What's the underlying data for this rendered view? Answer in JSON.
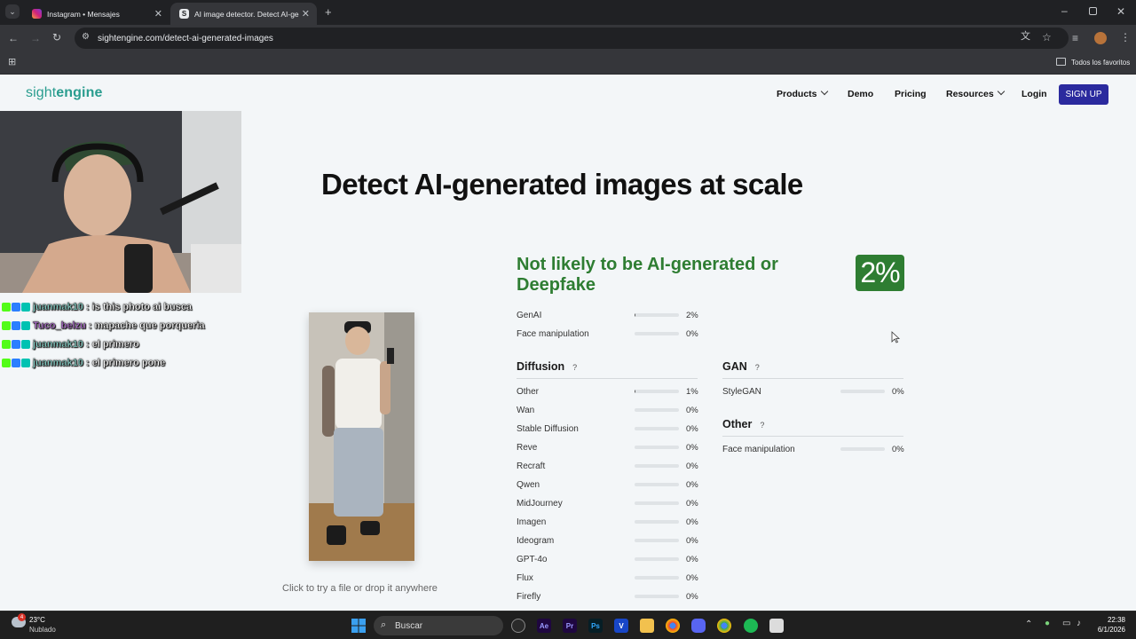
{
  "browser": {
    "tabs": [
      {
        "title": "Instagram • Mensajes"
      },
      {
        "title": "AI image detector. Detect AI-gen"
      }
    ],
    "url": "sightengine.com/detect-ai-generated-images",
    "bookmarks_label": "Todos los favoritos"
  },
  "site": {
    "logo_light": "sight",
    "logo_bold": "engine",
    "nav": {
      "products": "Products",
      "demo": "Demo",
      "pricing": "Pricing",
      "resources": "Resources",
      "login": "Login",
      "signup": "SIGN UP"
    },
    "headline": "Detect AI-generated images at scale",
    "result_title": "Not likely to be AI-generated or Deepfake",
    "score": "2%",
    "drop_hint": "Click to try a file or drop it anywhere"
  },
  "results": {
    "summary": [
      {
        "label": "GenAI",
        "pct": "2%",
        "value": 0.02
      },
      {
        "label": "Face manipulation",
        "pct": "0%",
        "value": 0
      }
    ],
    "diffusion": {
      "title": "Diffusion",
      "help": "?",
      "items": [
        {
          "label": "Other",
          "pct": "1%",
          "value": 0.01
        },
        {
          "label": "Wan",
          "pct": "0%",
          "value": 0
        },
        {
          "label": "Stable Diffusion",
          "pct": "0%",
          "value": 0
        },
        {
          "label": "Reve",
          "pct": "0%",
          "value": 0
        },
        {
          "label": "Recraft",
          "pct": "0%",
          "value": 0
        },
        {
          "label": "Qwen",
          "pct": "0%",
          "value": 0
        },
        {
          "label": "MidJourney",
          "pct": "0%",
          "value": 0
        },
        {
          "label": "Imagen",
          "pct": "0%",
          "value": 0
        },
        {
          "label": "Ideogram",
          "pct": "0%",
          "value": 0
        },
        {
          "label": "GPT-4o",
          "pct": "0%",
          "value": 0
        },
        {
          "label": "Flux",
          "pct": "0%",
          "value": 0
        },
        {
          "label": "Firefly",
          "pct": "0%",
          "value": 0
        }
      ]
    },
    "gan": {
      "title": "GAN",
      "help": "?",
      "items": [
        {
          "label": "StyleGAN",
          "pct": "0%",
          "value": 0
        }
      ]
    },
    "other": {
      "title": "Other",
      "help": "?",
      "items": [
        {
          "label": "Face manipulation",
          "pct": "0%",
          "value": 0
        }
      ]
    }
  },
  "chat": [
    {
      "user": "juanmak10",
      "message": ": is this photo ai busca",
      "color": "#7fd1c7"
    },
    {
      "user": "Tuco_belzu",
      "message": ": mapache que porqueria",
      "color": "#b36bd6"
    },
    {
      "user": "juanmak10",
      "message": ": el primero",
      "color": "#7fd1c7"
    },
    {
      "user": "juanmak10",
      "message": ": el primero pone",
      "color": "#7fd1c7"
    }
  ],
  "taskbar": {
    "weather_temp": "23°C",
    "weather_desc": "Nublado",
    "search": "Buscar",
    "time": "22:38",
    "date": "6/1/2026",
    "notif_count": "4",
    "apps": [
      "Ae",
      "Pr",
      "Ps",
      "V"
    ]
  },
  "colors": {
    "accent": "#2b2a9e",
    "result_green": "#2e7d32",
    "logo_teal": "#2a9d8f"
  }
}
